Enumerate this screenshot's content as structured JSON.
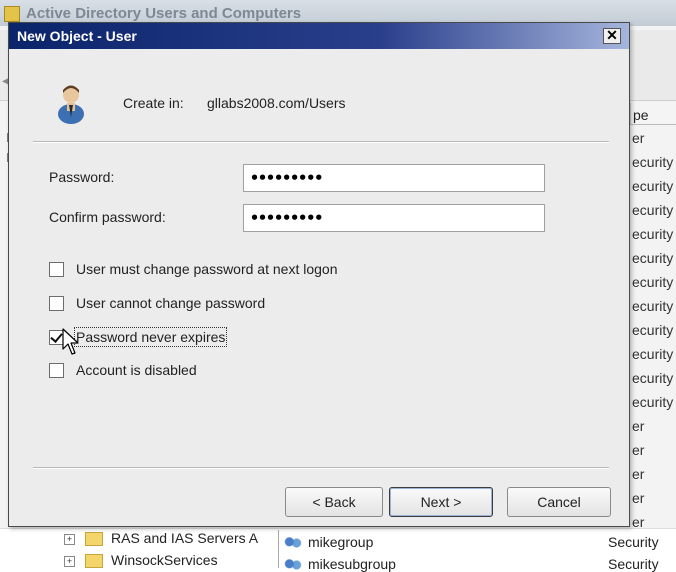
{
  "background_window": {
    "title": "Active Directory Users and Computers",
    "type_column_header": "pe",
    "type_fragments": [
      "er",
      "ecurity",
      "ecurity",
      "ecurity",
      "ecurity",
      "ecurity",
      "ecurity",
      "ecurity",
      "ecurity",
      "ecurity",
      "ecurity",
      "ecurity",
      "er",
      "er",
      "er",
      "er",
      "er"
    ],
    "left_fragments": [
      "E",
      "E"
    ],
    "tree_items": [
      {
        "label": "RAS and IAS Servers A"
      },
      {
        "label": "WinsockServices"
      }
    ],
    "list_items": [
      {
        "name": "mikegroup",
        "type": "Security"
      },
      {
        "name": "mikesubgroup",
        "type": "Security"
      }
    ]
  },
  "dialog": {
    "title": "New Object - User",
    "close_label": "✕",
    "create_in_label": "Create in:",
    "create_in_path": "gllabs2008.com/Users",
    "password_label": "Password:",
    "password_value": "•••••••••",
    "confirm_label": "Confirm password:",
    "confirm_value": "•••••••••",
    "options": [
      {
        "label": "User must change password at next logon",
        "checked": false
      },
      {
        "label": "User cannot change password",
        "checked": false
      },
      {
        "label": "Password never expires",
        "checked": true
      },
      {
        "label": "Account is disabled",
        "checked": false
      }
    ],
    "buttons": {
      "back": "< Back",
      "next": "Next >",
      "cancel": "Cancel"
    }
  },
  "colors": {
    "title_bar": "#0a246a",
    "dialog_bg": "#ececec"
  }
}
